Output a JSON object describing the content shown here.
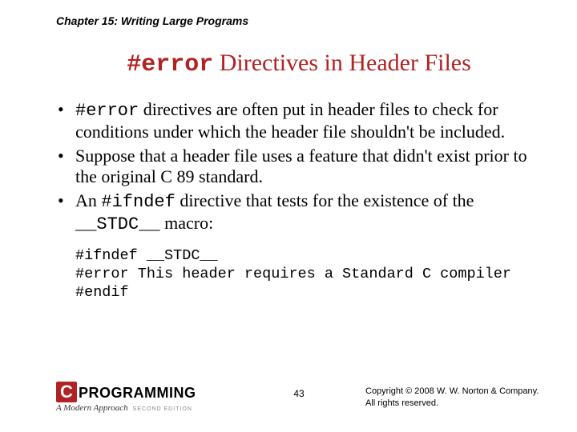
{
  "chapter": "Chapter 15: Writing Large Programs",
  "title": {
    "code": "#error",
    "rest": " Directives in Header Files"
  },
  "bullets": [
    {
      "pre": "#error",
      "text": " directives are often put in header files to check for conditions under which the header file shouldn't be included."
    },
    {
      "text": "Suppose that a header file uses a feature that didn't exist prior to the original C 89 standard."
    },
    {
      "text_a": "An ",
      "code_a": "#ifndef",
      "text_b": " directive that tests for the existence of the ",
      "code_b": "__STDC__",
      "text_c": " macro:"
    }
  ],
  "code": "#ifndef __STDC__\n#error This header requires a Standard C compiler\n#endif",
  "footer": {
    "logo_c": "C",
    "logo_text": "PROGRAMMING",
    "logo_sub": "A Modern Approach",
    "logo_ed": "SECOND EDITION",
    "page": "43",
    "copyright_l1": "Copyright © 2008 W. W. Norton & Company.",
    "copyright_l2": "All rights reserved."
  }
}
